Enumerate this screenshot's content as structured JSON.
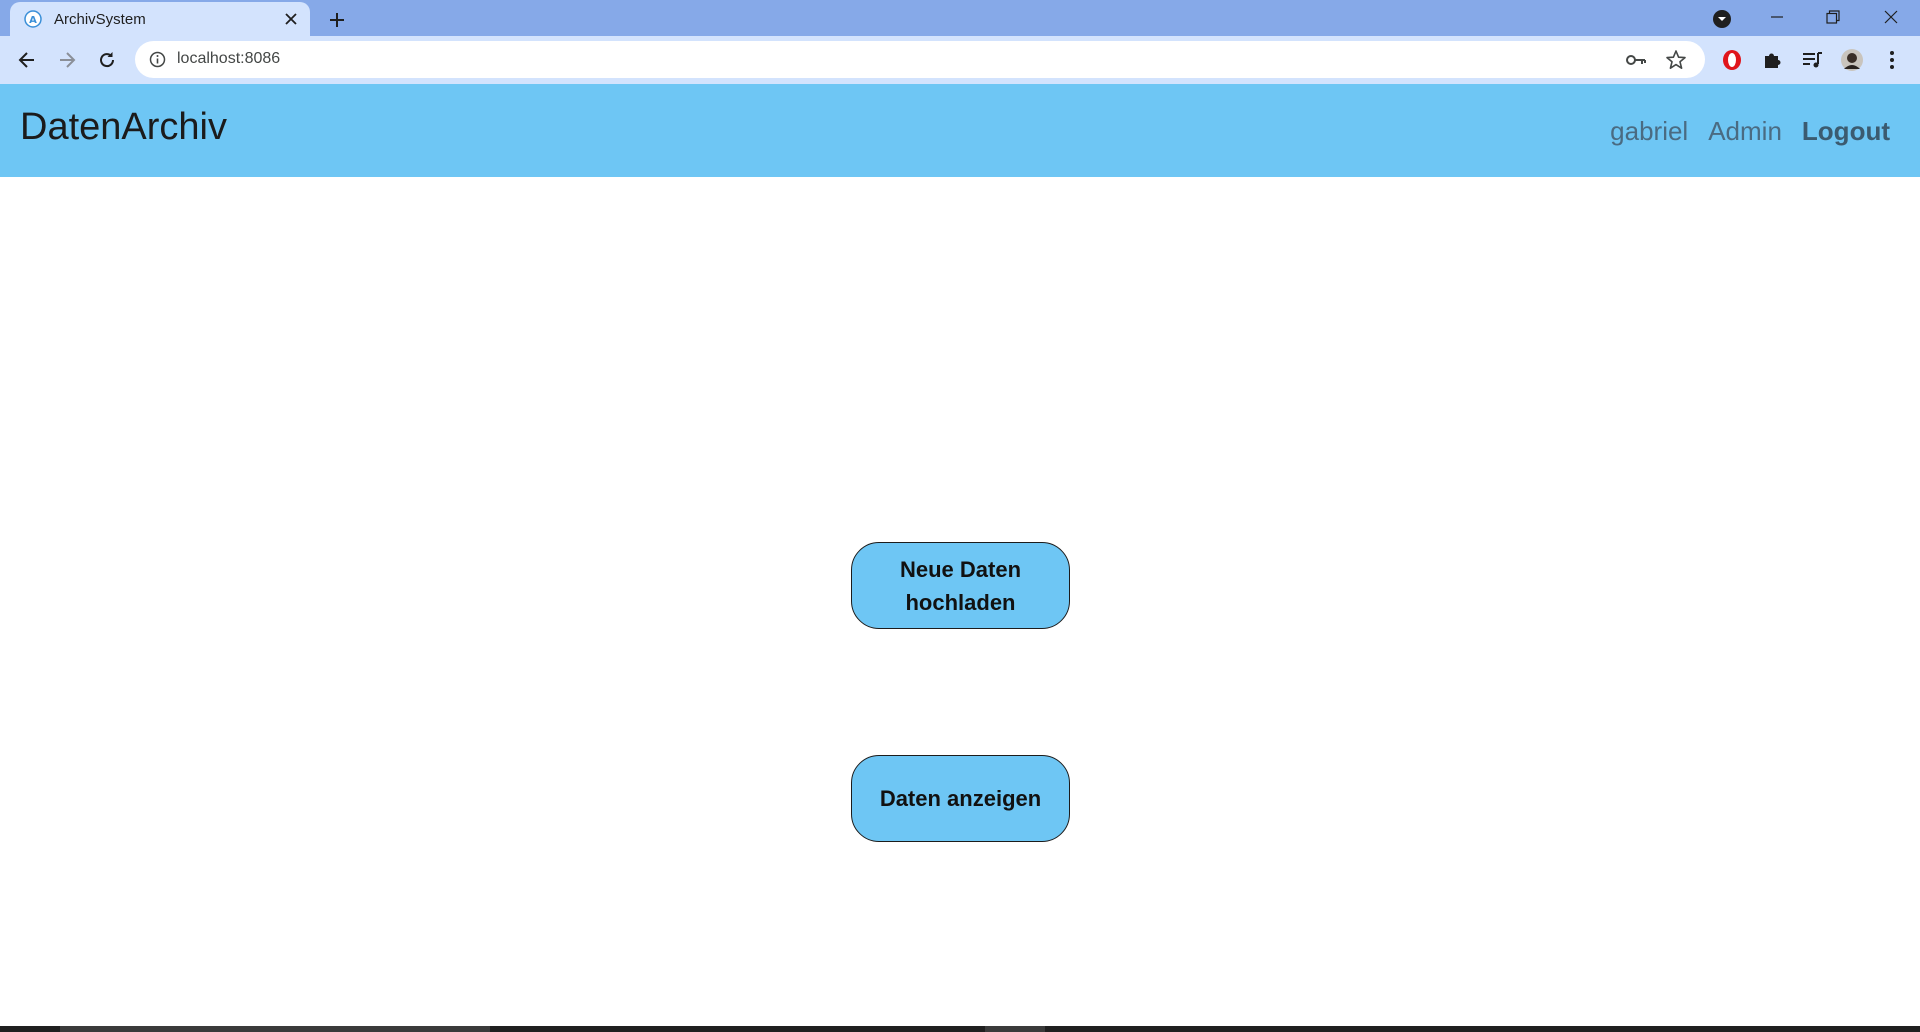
{
  "browser": {
    "tab_title": "ArchivSystem",
    "url": "localhost:8086"
  },
  "icons": {
    "favicon": "archivsystem-favicon",
    "tab_close": "close-icon",
    "new_tab": "plus-icon",
    "tab_search": "chevron-down-circle-icon",
    "minimize": "minimize-icon",
    "restore": "restore-icon",
    "close_window": "close-icon",
    "back": "arrow-left-icon",
    "forward": "arrow-right-icon",
    "reload": "reload-icon",
    "site_info": "info-icon",
    "password": "key-icon",
    "bookmark": "star-icon",
    "extension_opera": "opera-icon",
    "extensions": "puzzle-icon",
    "media": "media-queue-icon",
    "profile": "avatar",
    "menu": "kebab-menu-icon"
  },
  "colors": {
    "navbar": "#6ec6f4",
    "button": "#6ec6f4",
    "tabstrip": "#86a9e8",
    "toolbar": "#d3e3fd"
  },
  "navbar": {
    "brand": "DatenArchiv",
    "user": "gabriel",
    "admin": "Admin",
    "logout": "Logout"
  },
  "main": {
    "upload_button": "Neue Daten hochladen",
    "view_button": "Daten anzeigen"
  }
}
